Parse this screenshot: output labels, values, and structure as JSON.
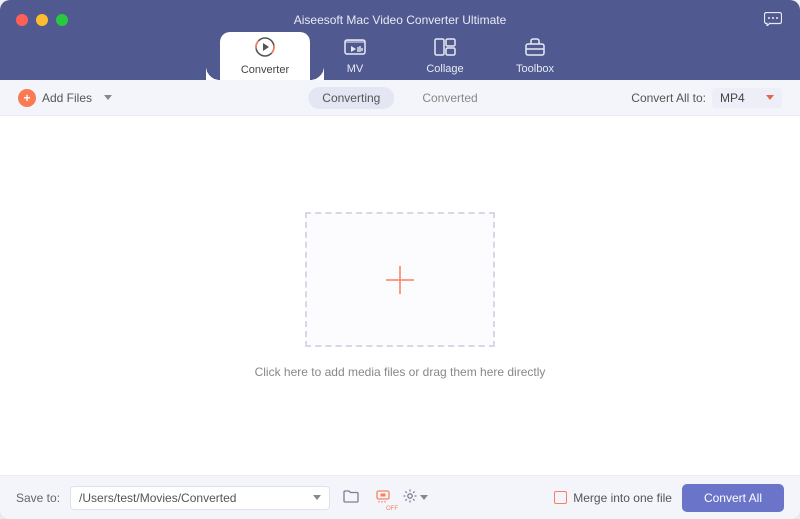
{
  "window": {
    "title": "Aiseesoft Mac Video Converter Ultimate"
  },
  "tabs": {
    "converter": "Converter",
    "mv": "MV",
    "collage": "Collage",
    "toolbox": "Toolbox"
  },
  "subbar": {
    "add_files": "Add Files",
    "converting": "Converting",
    "converted": "Converted",
    "convert_all_to_label": "Convert All to:",
    "format": "MP4"
  },
  "dropzone": {
    "hint": "Click here to add media files or drag them here directly"
  },
  "footer": {
    "save_to_label": "Save to:",
    "save_path": "/Users/test/Movies/Converted",
    "merge_label": "Merge into one file",
    "convert_btn": "Convert All"
  }
}
